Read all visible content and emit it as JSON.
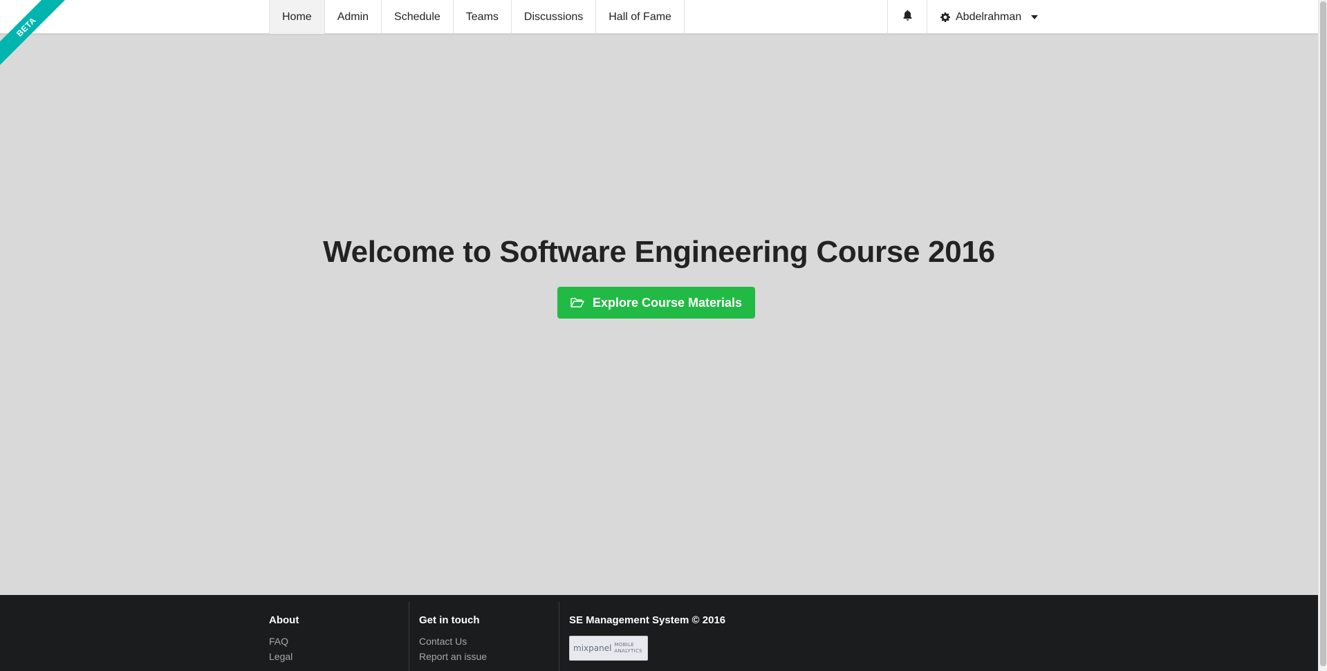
{
  "ribbon": {
    "label": "BETA"
  },
  "nav": {
    "items": [
      {
        "label": "Home",
        "active": true
      },
      {
        "label": "Admin"
      },
      {
        "label": "Schedule"
      },
      {
        "label": "Teams"
      },
      {
        "label": "Discussions"
      },
      {
        "label": "Hall of Fame"
      }
    ],
    "bell_icon": "bell-icon",
    "user": {
      "name": "Abdelrahman",
      "icon": "gear-icon"
    }
  },
  "hero": {
    "title": "Welcome to Software Engineering Course 2016",
    "cta_label": "Explore Course Materials",
    "cta_icon": "folder-open-icon",
    "cta_color": "#21ba45"
  },
  "footer": {
    "about": {
      "title": "About",
      "links": [
        "FAQ",
        "Legal"
      ]
    },
    "contact": {
      "title": "Get in touch",
      "links": [
        "Contact Us",
        "Report an issue"
      ]
    },
    "brand": {
      "title": "SE Management System © 2016",
      "badge_name": "mixpanel",
      "badge_line1": "MOBILE",
      "badge_line2": "ANALYTICS"
    }
  },
  "colors": {
    "ribbon": "#00b5ad",
    "footer_bg": "#1b1c1d",
    "page_bg": "#d9d9d9"
  }
}
